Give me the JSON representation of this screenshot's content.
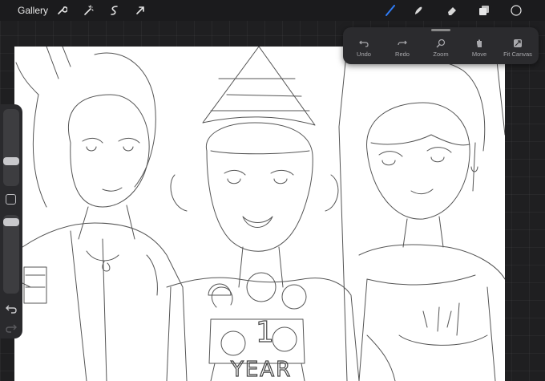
{
  "toolbar": {
    "gallery_label": "Gallery",
    "left_icons": [
      "wrench-icon",
      "magic-wand-icon",
      "selection-icon",
      "transform-arrow-icon"
    ],
    "right_icons": [
      "brush-icon",
      "smudge-icon",
      "eraser-icon",
      "layers-icon",
      "color-swatch-icon"
    ],
    "accent_color": "#2f7cf6"
  },
  "gesture_menu": {
    "items": [
      {
        "label": "Undo",
        "icon": "undo-icon"
      },
      {
        "label": "Redo",
        "icon": "redo-icon"
      },
      {
        "label": "Zoom",
        "icon": "zoom-icon"
      },
      {
        "label": "Move",
        "icon": "move-hand-icon"
      },
      {
        "label": "Fit Canvas",
        "icon": "fit-canvas-icon"
      }
    ]
  },
  "sidebar": {
    "brush_size_level": 0.3,
    "opacity_level": 0.95,
    "icons": [
      "modify-square-icon",
      "undo-icon",
      "redo-icon"
    ]
  },
  "canvas": {
    "background": "#ffffff",
    "artwork_text": [
      "YEAR",
      "1"
    ]
  }
}
